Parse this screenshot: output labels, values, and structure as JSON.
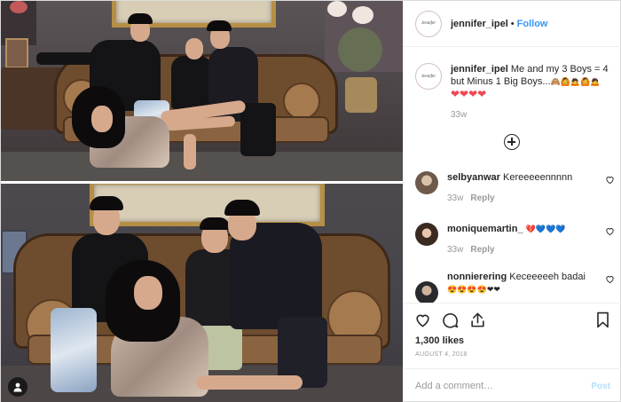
{
  "header": {
    "username": "jennifer_ipel",
    "separator": "•",
    "follow_label": "Follow",
    "avatar_text": "Jennifer"
  },
  "caption": {
    "username": "jennifer_ipel",
    "text": "Me and my 3 Boys = 4 but Minus 1 Big Boys...",
    "emojis": "🙈🙆🙇🙆🙇",
    "hearts": "❤❤❤❤",
    "age": "33w"
  },
  "load_more_icon": "plus-circle-icon",
  "comments": [
    {
      "username": "selbyanwar",
      "text": "Kereeeeennnnn",
      "emojis": "",
      "age": "33w",
      "reply_label": "Reply"
    },
    {
      "username": "moniquemartin_",
      "text": "",
      "emojis": "💔💙💙💙",
      "age": "33w",
      "reply_label": "Reply"
    },
    {
      "username": "nonnierering",
      "text": "Keceeeeeh badai",
      "emojis": "😍😍😍😍❤❤",
      "age": "",
      "reply_label": ""
    }
  ],
  "actions": {
    "likes": "1,300 likes",
    "date": "AUGUST 4, 2018",
    "icons": [
      "heart-icon",
      "comment-icon",
      "share-icon",
      "bookmark-icon"
    ]
  },
  "add_comment": {
    "placeholder": "Add a comment…",
    "post_label": "Post"
  },
  "colors": {
    "link": "#3897f0",
    "post_disabled": "#b2dffc",
    "muted": "#999999"
  }
}
